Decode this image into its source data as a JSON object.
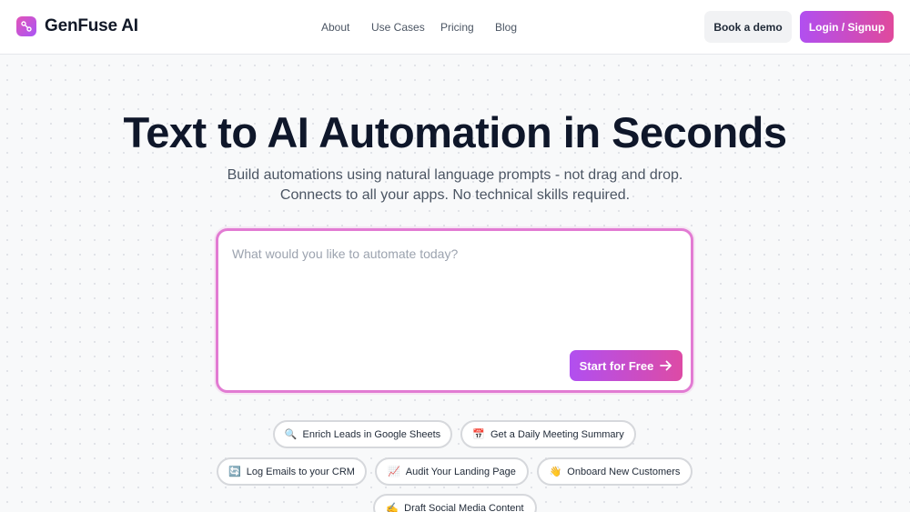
{
  "header": {
    "brand": "GenFuse AI",
    "nav": [
      {
        "label": "About"
      },
      {
        "label": "Use Cases"
      },
      {
        "label": "Pricing"
      },
      {
        "label": "Blog"
      }
    ],
    "book_demo_label": "Book a demo",
    "login_label": "Login / Signup"
  },
  "hero": {
    "title": "Text to AI Automation in Seconds",
    "subtitle_line1": "Build automations using natural language prompts - not drag and drop.",
    "subtitle_line2": "Connects to all your apps. No technical skills required."
  },
  "prompt": {
    "placeholder": "What would you like to automate today?",
    "value": "",
    "start_label": "Start for Free"
  },
  "suggestions": [
    {
      "icon": "🔍",
      "label": "Enrich Leads in Google Sheets"
    },
    {
      "icon": "📅",
      "label": "Get a Daily Meeting Summary"
    },
    {
      "icon": "🔄",
      "label": "Log Emails to your CRM"
    },
    {
      "icon": "📈",
      "label": "Audit Your Landing Page"
    },
    {
      "icon": "👋",
      "label": "Onboard New Customers"
    },
    {
      "icon": "✍️",
      "label": "Draft Social Media Content"
    }
  ],
  "colors": {
    "accent_start": "#b14ff0",
    "accent_end": "#e04a9c",
    "prompt_border": "#e27bd3"
  }
}
